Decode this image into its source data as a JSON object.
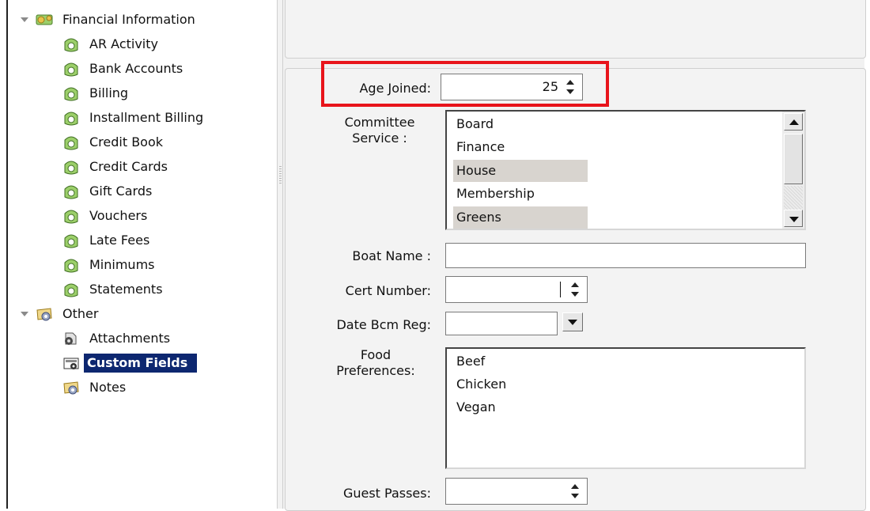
{
  "tree": {
    "groups": [
      {
        "label": "Financial Information",
        "expanded": true,
        "items": [
          "AR Activity",
          "Bank Accounts",
          "Billing",
          "Installment Billing",
          "Credit Book",
          "Credit Cards",
          "Gift Cards",
          "Vouchers",
          "Late Fees",
          "Minimums",
          "Statements"
        ]
      },
      {
        "label": "Other",
        "expanded": true,
        "items": [
          "Attachments",
          "Custom Fields",
          "Notes"
        ]
      }
    ],
    "selected": "Custom Fields"
  },
  "form": {
    "age_joined": {
      "label": "Age Joined:",
      "value": "25"
    },
    "committee_service": {
      "label_line1": "Committee",
      "label_line2": "Service :",
      "options": [
        "Board",
        "Finance",
        "House",
        "Membership",
        "Greens"
      ],
      "selected": [
        "House",
        "Greens"
      ]
    },
    "boat_name": {
      "label": "Boat Name :",
      "value": ""
    },
    "cert_number": {
      "label": "Cert Number:",
      "value": ""
    },
    "date_bcm_reg": {
      "label": "Date Bcm Reg:",
      "value": ""
    },
    "food_preferences": {
      "label_line1": "Food",
      "label_line2": "Preferences:",
      "options": [
        "Beef",
        "Chicken",
        "Vegan"
      ]
    },
    "guest_passes": {
      "label": "Guest Passes:",
      "value": ""
    }
  },
  "colors": {
    "selection_bg": "#0d2770",
    "highlight_box": "#e8141b",
    "list_selected_bg": "#d8d4cf"
  }
}
